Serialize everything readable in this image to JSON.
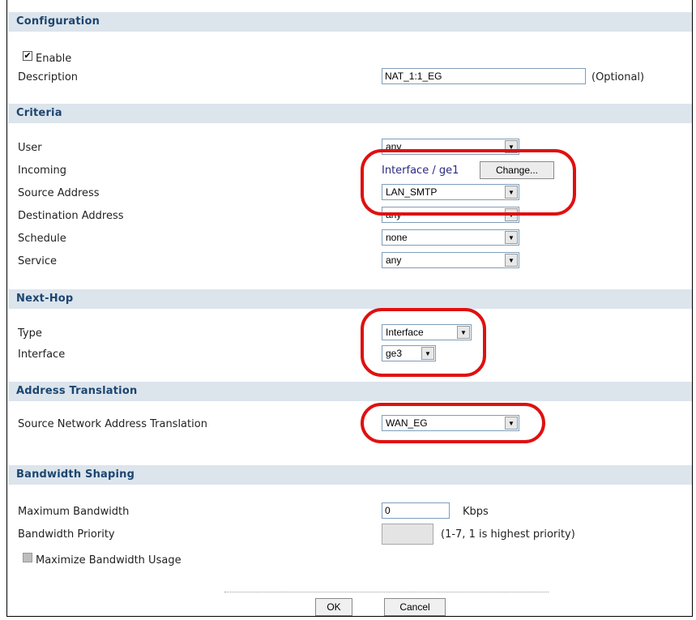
{
  "sections": {
    "configuration": "Configuration",
    "criteria": "Criteria",
    "next_hop": "Next-Hop",
    "address_translation": "Address Translation",
    "bandwidth_shaping": "Bandwidth Shaping"
  },
  "configuration": {
    "enable_label": "Enable",
    "enable_checked": true,
    "description_label": "Description",
    "description_value": "NAT_1:1_EG",
    "optional_hint": "(Optional)"
  },
  "criteria": {
    "user_label": "User",
    "user_value": "any",
    "incoming_label": "Incoming",
    "incoming_value": "Interface / ge1",
    "change_button": "Change...",
    "source_label": "Source Address",
    "source_value": "LAN_SMTP",
    "destination_label": "Destination Address",
    "destination_value": "any",
    "schedule_label": "Schedule",
    "schedule_value": "none",
    "service_label": "Service",
    "service_value": "any"
  },
  "next_hop": {
    "type_label": "Type",
    "type_value": "Interface",
    "interface_label": "Interface",
    "interface_value": "ge3"
  },
  "address_translation": {
    "snat_label": "Source Network Address Translation",
    "snat_value": "WAN_EG"
  },
  "bandwidth": {
    "max_label": "Maximum Bandwidth",
    "max_value": "0",
    "max_unit": "Kbps",
    "priority_label": "Bandwidth Priority",
    "priority_value": "",
    "priority_hint": "(1-7, 1 is highest priority)",
    "maximize_label": "Maximize Bandwidth Usage",
    "maximize_checked": false
  },
  "buttons": {
    "ok": "OK",
    "cancel": "Cancel"
  },
  "colors": {
    "section_bar": "#dce4ec",
    "section_title": "#1c4670",
    "annotation": "#e01010",
    "link_text": "#2a2a80"
  }
}
